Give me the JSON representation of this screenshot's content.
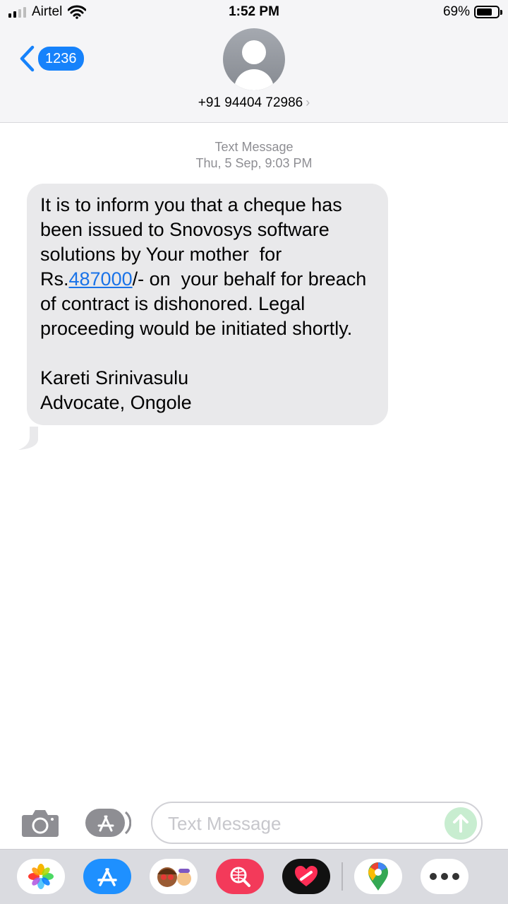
{
  "status_bar": {
    "carrier": "Airtel",
    "time": "1:52 PM",
    "battery_percent": "69%"
  },
  "nav": {
    "back_badge": "1236",
    "contact_number": "+91 94404 72986",
    "contact_chevron": "›"
  },
  "conversation": {
    "message_type": "Text Message",
    "date": "Thu, 5 Sep, 9:03 PM",
    "message": {
      "part1": "It is to inform you that a cheque has been issued to Snovosys software solutions by Your mother  for Rs.",
      "link": "487000",
      "part2": "/- on  your behalf for breach of contract is dishonored. Legal proceeding would be initiated shortly.\n\nKareti Srinivasulu\nAdvocate, Ongole"
    }
  },
  "composer": {
    "placeholder": "Text Message"
  },
  "app_drawer": {
    "apps": [
      "photos-icon",
      "app-store-icon",
      "memoji-icon",
      "web-search-icon",
      "digital-touch-icon",
      "google-maps-icon",
      "more-icon"
    ]
  },
  "colors": {
    "accent": "#1682fb",
    "bubble": "#e9e9eb",
    "link": "#1a73e8",
    "send_disabled": "#c8edd0"
  }
}
